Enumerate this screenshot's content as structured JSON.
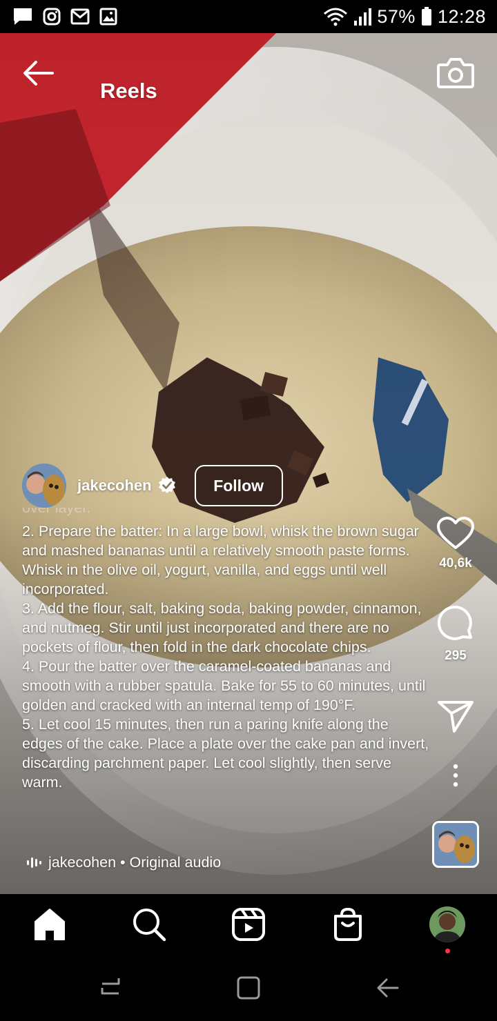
{
  "status_bar": {
    "left_icons": [
      "message-icon",
      "instagram-icon",
      "gmail-icon",
      "gallery-icon"
    ],
    "right_icons": [
      "wifi-icon",
      "signal-icon",
      "battery-icon"
    ],
    "battery": "57%",
    "time": "12:28"
  },
  "header": {
    "title": "Reels",
    "back_icon": "arrow-left-icon",
    "camera_icon": "camera-icon"
  },
  "post": {
    "username": "jakecohen",
    "verified": true,
    "follow_label": "Follow",
    "caption_partial_top": "over layer.",
    "caption": "2. Prepare the batter: In a large bowl, whisk the brown sugar and mashed bananas until a relatively smooth paste forms. Whisk in the olive oil, yogurt, vanilla, and eggs until well incorporated.\n3. Add the flour, salt, baking soda, baking powder, cinnamon, and nutmeg. Stir until just incorporated and there are no pockets of flour, then fold in the dark chocolate chips.\n4. Pour the batter over the caramel-coated bananas and smooth with a rubber spatula. Bake for 55 to 60 minutes, until golden and cracked with an internal temp of 190°F.\n5. Let cool 15 minutes, then run a paring knife along the edges of the cake. Place a plate over the cake pan and invert, discarding parchment paper. Let cool slightly, then serve warm.",
    "audio_text": "jakecohen • Original audio"
  },
  "actions": {
    "likes": "40,6k",
    "comments": "295",
    "icons": [
      "heart-icon",
      "comment-icon",
      "send-icon",
      "more-icon"
    ]
  },
  "bottom_nav": {
    "items": [
      "home-icon",
      "search-icon",
      "reels-icon",
      "shop-icon",
      "profile-avatar"
    ]
  },
  "system_nav": {
    "items": [
      "recents-icon",
      "home-button-icon",
      "back-icon"
    ]
  },
  "colors": {
    "background": "#000000",
    "text": "#ffffff",
    "notification_dot": "#ff3040",
    "verified_badge": "#ffffff"
  }
}
